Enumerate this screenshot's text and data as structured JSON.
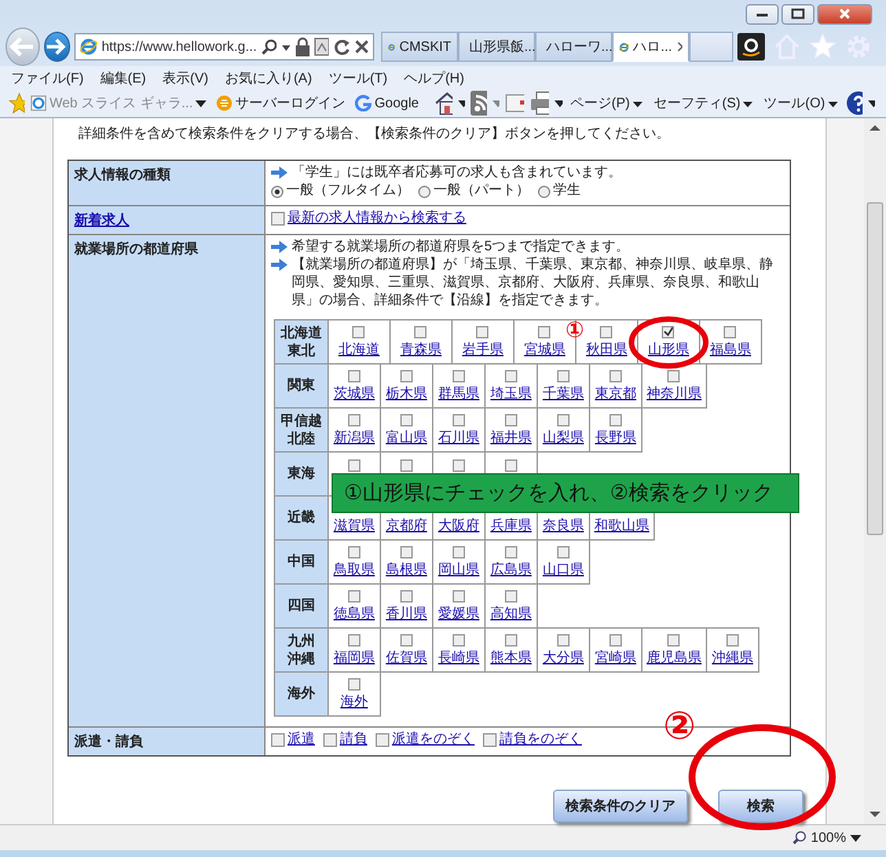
{
  "browser": {
    "address": "https://www.hellowork.g...",
    "tabs": [
      {
        "label": "CMSKIT",
        "selected": false
      },
      {
        "label": "山形県飯...",
        "selected": false
      },
      {
        "label": "ハローワ...",
        "selected": false
      },
      {
        "label": "ハロ...",
        "selected": true
      }
    ],
    "menu": [
      "ファイル(F)",
      "編集(E)",
      "表示(V)",
      "お気に入り(A)",
      "ツール(T)",
      "ヘルプ(H)"
    ],
    "favorites": [
      "Web スライス ギャラ...",
      "サーバーログイン",
      "Google"
    ],
    "commands": [
      "ページ(P)",
      "セーフティ(S)",
      "ツール(O)"
    ],
    "zoom": "100%"
  },
  "intro": "詳細条件を含めて検索条件をクリアする場合、【検索条件のクリア】ボタンを押してください。",
  "form": [
    {
      "kind": "radio",
      "label": "求人情報の種類",
      "notes": [
        "「学生」には既卒者応募可の求人も含まれています。"
      ],
      "options": [
        {
          "label": "一般（フルタイム）",
          "selected": true
        },
        {
          "label": "一般（パート）",
          "selected": false
        },
        {
          "label": "学生",
          "selected": false
        }
      ]
    },
    {
      "kind": "link",
      "label": "新着求人",
      "options": [
        {
          "label": "最新の求人情報から検索する",
          "checked": false
        }
      ]
    },
    {
      "kind": "prefectures",
      "label": "就業場所の都道府県",
      "notes": [
        "希望する就業場所の都道府県を5つまで指定できます。",
        "【就業場所の都道府県】が「埼玉県、千葉県、東京都、神奈川県、岐阜県、静岡県、愛知県、三重県、滋賀県、京都府、大阪府、兵庫県、奈良県、和歌山県」の場合、詳細条件で【沿線】を指定できます。"
      ],
      "regions": [
        {
          "name": [
            "北海道",
            "東北"
          ],
          "prefectures": [
            {
              "name": "北海道",
              "checked": false
            },
            {
              "name": "青森県",
              "checked": false
            },
            {
              "name": "岩手県",
              "checked": false
            },
            {
              "name": "宮城県",
              "checked": false
            },
            {
              "name": "秋田県",
              "checked": false
            },
            {
              "name": "山形県",
              "checked": true
            },
            {
              "name": "福島県",
              "checked": false
            }
          ]
        },
        {
          "name": [
            "関東"
          ],
          "prefectures": [
            {
              "name": "茨城県",
              "checked": false
            },
            {
              "name": "栃木県",
              "checked": false
            },
            {
              "name": "群馬県",
              "checked": false
            },
            {
              "name": "埼玉県",
              "checked": false
            },
            {
              "name": "千葉県",
              "checked": false
            },
            {
              "name": "東京都",
              "checked": false
            },
            {
              "name": "神奈川県",
              "checked": false
            }
          ]
        },
        {
          "name": [
            "甲信越",
            "北陸"
          ],
          "prefectures": [
            {
              "name": "新潟県",
              "checked": false
            },
            {
              "name": "富山県",
              "checked": false
            },
            {
              "name": "石川県",
              "checked": false
            },
            {
              "name": "福井県",
              "checked": false
            },
            {
              "name": "山梨県",
              "checked": false
            },
            {
              "name": "長野県",
              "checked": false
            }
          ]
        },
        {
          "name": [
            "東海"
          ],
          "prefectures": [
            {
              "checked": false
            },
            {
              "checked": false
            },
            {
              "checked": false
            },
            {
              "checked": false
            }
          ]
        },
        {
          "name": [
            "近畿"
          ],
          "prefectures": [
            {
              "name": "滋賀県"
            },
            {
              "name": "京都府"
            },
            {
              "name": "大阪府"
            },
            {
              "name": "兵庫県"
            },
            {
              "name": "奈良県"
            },
            {
              "name": "和歌山県"
            }
          ]
        },
        {
          "name": [
            "中国"
          ],
          "prefectures": [
            {
              "name": "鳥取県",
              "checked": false
            },
            {
              "name": "島根県",
              "checked": false
            },
            {
              "name": "岡山県",
              "checked": false
            },
            {
              "name": "広島県",
              "checked": false
            },
            {
              "name": "山口県",
              "checked": false
            }
          ]
        },
        {
          "name": [
            "四国"
          ],
          "prefectures": [
            {
              "name": "徳島県",
              "checked": false
            },
            {
              "name": "香川県",
              "checked": false
            },
            {
              "name": "愛媛県",
              "checked": false
            },
            {
              "name": "高知県",
              "checked": false
            }
          ]
        },
        {
          "name": [
            "九州",
            "沖縄"
          ],
          "prefectures": [
            {
              "name": "福岡県",
              "checked": false
            },
            {
              "name": "佐賀県",
              "checked": false
            },
            {
              "name": "長崎県",
              "checked": false
            },
            {
              "name": "熊本県",
              "checked": false
            },
            {
              "name": "大分県",
              "checked": false
            },
            {
              "name": "宮崎県",
              "checked": false
            },
            {
              "name": "鹿児島県",
              "checked": false
            },
            {
              "name": "沖縄県",
              "checked": false
            }
          ]
        },
        {
          "name": [
            "海外"
          ],
          "prefectures": [
            {
              "name": "海外",
              "checked": false
            }
          ]
        }
      ]
    },
    {
      "kind": "checkboxes",
      "label": "派遣・請負",
      "options": [
        {
          "label": "派遣",
          "checked": false
        },
        {
          "label": "請負",
          "checked": false
        },
        {
          "label": "派遣をのぞく",
          "checked": false
        },
        {
          "label": "請負をのぞく",
          "checked": false
        }
      ]
    }
  ],
  "buttons": [
    "検索条件のクリア",
    "検索"
  ],
  "annotations": {
    "step1": "①",
    "step2": "②",
    "banner": "①山形県にチェックを入れ、②検索をクリック"
  }
}
